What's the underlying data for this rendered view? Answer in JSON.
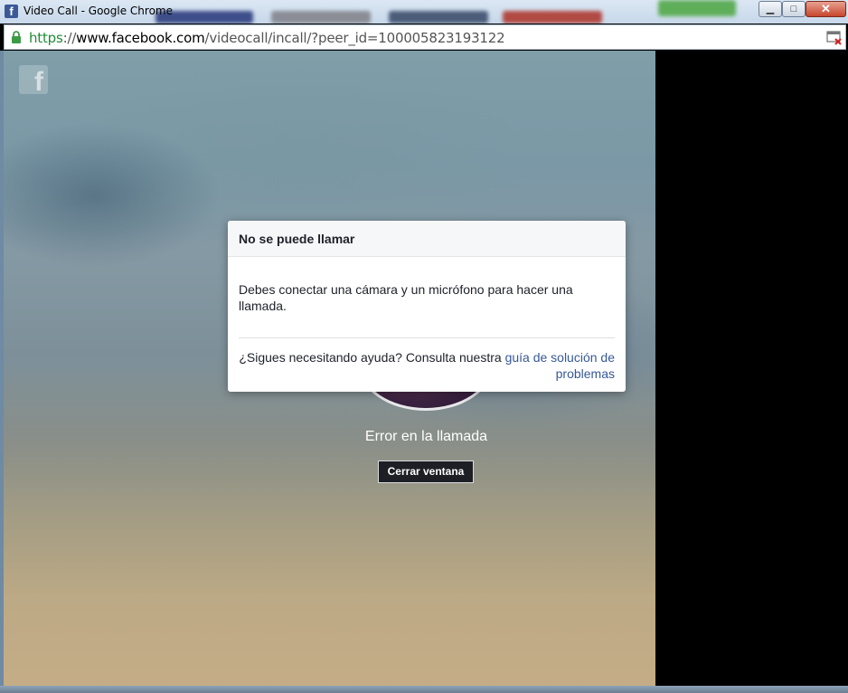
{
  "window": {
    "title": "Video Call - Google Chrome",
    "app_icon": "f",
    "minimize_glyph": "▁",
    "maximize_glyph": "□",
    "close_glyph": "✕"
  },
  "address_bar": {
    "scheme": "https",
    "separator": "://",
    "host": "www.facebook.com",
    "path": "/videocall/incall/?peer_id=100005823193122",
    "lock_icon": "lock-icon",
    "blocked_popup_icon": "popup-blocked-icon"
  },
  "page": {
    "logo": "f",
    "call_status": "Error en la llamada",
    "close_button_label": "Cerrar ventana"
  },
  "dialog": {
    "title": "No se puede llamar",
    "message": "Debes conectar una cámara y un micrófono para hacer una llamada.",
    "help_prefix": "¿Sigues necesitando ayuda? Consulta nuestra ",
    "help_link": "guía de solución de problemas"
  },
  "colors": {
    "facebook_blue": "#3b5998",
    "link_blue": "#365899",
    "secure_green": "#1f8c37",
    "close_button_bg": "#1d1f24"
  }
}
